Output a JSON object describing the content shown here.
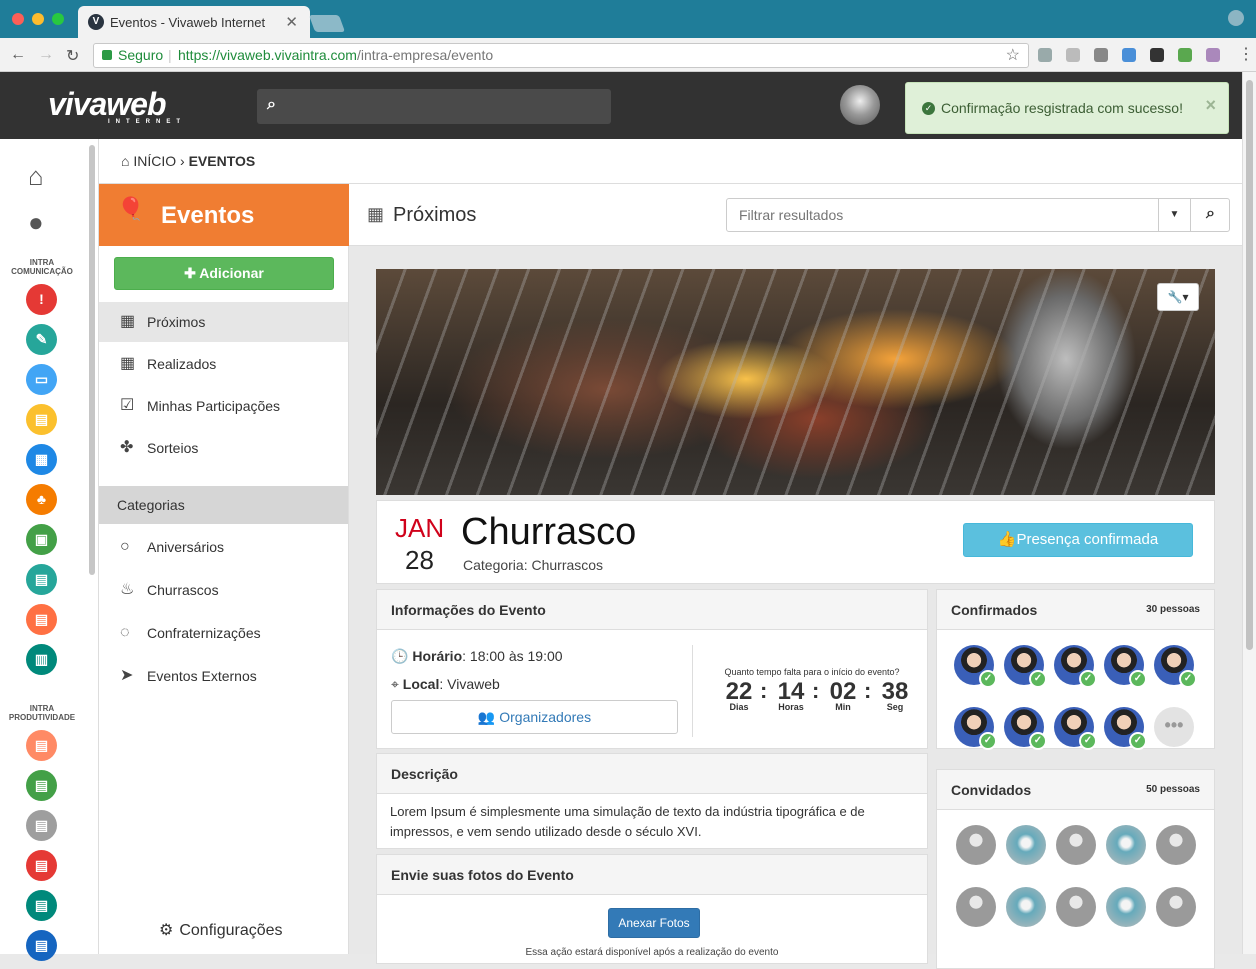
{
  "browser": {
    "tab_title": "Eventos - Vivaweb Internet",
    "tab_favicon": "V",
    "secure_label": "Seguro",
    "url_host": "https://vivaweb.vivaintra.com",
    "url_path": "/intra-empresa/evento"
  },
  "header": {
    "logo_text": "vivaweb",
    "logo_sub": "INTERNET",
    "search_placeholder": ""
  },
  "toast": {
    "message": "Confirmação resgistrada com sucesso!",
    "close": "×"
  },
  "leftbar": {
    "section1": "INTRA COMUNICAÇÃO",
    "section2": "INTRA PRODUTIVIDADE",
    "icons1": [
      "#e53935",
      "#26a69a",
      "#42a5f5",
      "#fbc02d",
      "#1e88e5",
      "#f57c00",
      "#43a047",
      "#26a69a",
      "#ff7043",
      "#00897b"
    ],
    "icons2": [
      "#ff8a65",
      "#43a047",
      "#9e9e9e",
      "#e53935",
      "#00897b",
      "#1565c0"
    ]
  },
  "breadcrumb": {
    "home": "INÍCIO",
    "current": "EVENTOS"
  },
  "sidebar": {
    "title": "Eventos",
    "add_button": "Adicionar",
    "menu": [
      "Próximos",
      "Realizados",
      "Minhas Participações",
      "Sorteios"
    ],
    "categories_title": "Categorias",
    "categories": [
      "Aniversários",
      "Churrascos",
      "Confraternizações",
      "Eventos Externos"
    ],
    "settings": "Configurações"
  },
  "main": {
    "title": "Próximos",
    "filter_placeholder": "Filtrar resultados"
  },
  "event": {
    "month": "JAN",
    "day": "28",
    "name": "Churrasco",
    "category": "Categoria: Churrascos",
    "confirm_button": "Presença confirmada"
  },
  "info": {
    "title": "Informações do Evento",
    "time_label": "Horário",
    "time_value": ": 18:00 às 19:00",
    "place_label": "Local",
    "place_value": ": Vivaweb",
    "organizers_button": "Organizadores",
    "countdown_question": "Quanto tempo falta para o início do evento?",
    "countdown": [
      {
        "value": "22",
        "label": "Dias"
      },
      {
        "value": "14",
        "label": "Horas"
      },
      {
        "value": "02",
        "label": "Min"
      },
      {
        "value": "38",
        "label": "Seg"
      }
    ]
  },
  "description": {
    "title": "Descrição",
    "text": "Lorem Ipsum é simplesmente uma simulação de texto da indústria tipográfica e de impressos, e vem sendo utilizado desde o século XVI."
  },
  "photos": {
    "title": "Envie suas fotos do Evento",
    "button": "Anexar Fotos",
    "note": "Essa ação estará disponível após a realização do evento"
  },
  "confirmed": {
    "title": "Confirmados",
    "count": "30 pessoas"
  },
  "guests": {
    "title": "Convidados",
    "count": "50 pessoas"
  }
}
